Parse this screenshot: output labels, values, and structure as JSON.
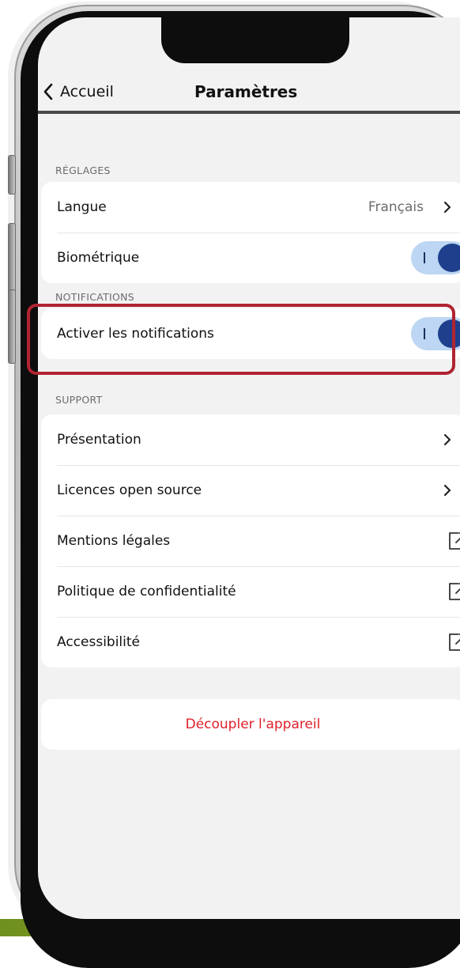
{
  "navbar": {
    "back_label": "Accueil",
    "title": "Paramètres"
  },
  "sections": {
    "reglages": {
      "header": "RÉGLAGES",
      "language_label": "Langue",
      "language_value": "Français",
      "biometric_label": "Biométrique",
      "biometric_on": true
    },
    "notifications": {
      "header": "NOTIFICATIONS",
      "enable_label": "Activer les notifications",
      "enable_on": true
    },
    "support": {
      "header": "SUPPORT",
      "items": [
        {
          "label": "Présentation",
          "icon": "chevron-right-icon"
        },
        {
          "label": "Licences open source",
          "icon": "chevron-right-icon"
        },
        {
          "label": "Mentions légales",
          "icon": "external-link-icon"
        },
        {
          "label": "Politique de confidentialité",
          "icon": "external-link-icon"
        },
        {
          "label": "Accessibilité",
          "icon": "external-link-icon"
        }
      ]
    }
  },
  "unpair_label": "Découpler l'appareil",
  "colors": {
    "accent_red": "#e0202b",
    "toggle_track": "#bcd6f3",
    "toggle_knob": "#1e3f8c",
    "highlight": "#b02431",
    "strip": "#86a52a"
  }
}
